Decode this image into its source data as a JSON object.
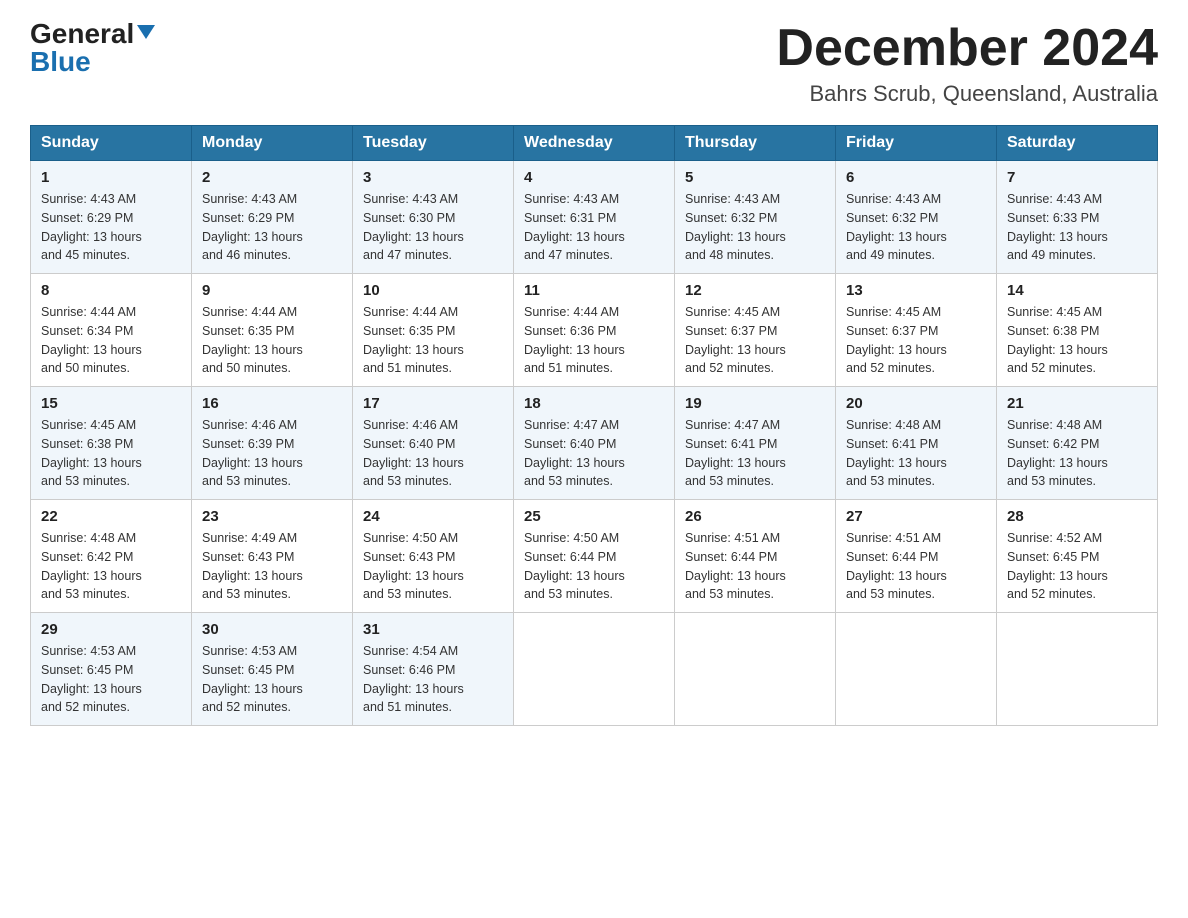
{
  "header": {
    "logo_general": "General",
    "logo_blue": "Blue",
    "title": "December 2024",
    "location": "Bahrs Scrub, Queensland, Australia"
  },
  "weekdays": [
    "Sunday",
    "Monday",
    "Tuesday",
    "Wednesday",
    "Thursday",
    "Friday",
    "Saturday"
  ],
  "weeks": [
    [
      {
        "day": "1",
        "sunrise": "4:43 AM",
        "sunset": "6:29 PM",
        "daylight": "13 hours and 45 minutes."
      },
      {
        "day": "2",
        "sunrise": "4:43 AM",
        "sunset": "6:29 PM",
        "daylight": "13 hours and 46 minutes."
      },
      {
        "day": "3",
        "sunrise": "4:43 AM",
        "sunset": "6:30 PM",
        "daylight": "13 hours and 47 minutes."
      },
      {
        "day": "4",
        "sunrise": "4:43 AM",
        "sunset": "6:31 PM",
        "daylight": "13 hours and 47 minutes."
      },
      {
        "day": "5",
        "sunrise": "4:43 AM",
        "sunset": "6:32 PM",
        "daylight": "13 hours and 48 minutes."
      },
      {
        "day": "6",
        "sunrise": "4:43 AM",
        "sunset": "6:32 PM",
        "daylight": "13 hours and 49 minutes."
      },
      {
        "day": "7",
        "sunrise": "4:43 AM",
        "sunset": "6:33 PM",
        "daylight": "13 hours and 49 minutes."
      }
    ],
    [
      {
        "day": "8",
        "sunrise": "4:44 AM",
        "sunset": "6:34 PM",
        "daylight": "13 hours and 50 minutes."
      },
      {
        "day": "9",
        "sunrise": "4:44 AM",
        "sunset": "6:35 PM",
        "daylight": "13 hours and 50 minutes."
      },
      {
        "day": "10",
        "sunrise": "4:44 AM",
        "sunset": "6:35 PM",
        "daylight": "13 hours and 51 minutes."
      },
      {
        "day": "11",
        "sunrise": "4:44 AM",
        "sunset": "6:36 PM",
        "daylight": "13 hours and 51 minutes."
      },
      {
        "day": "12",
        "sunrise": "4:45 AM",
        "sunset": "6:37 PM",
        "daylight": "13 hours and 52 minutes."
      },
      {
        "day": "13",
        "sunrise": "4:45 AM",
        "sunset": "6:37 PM",
        "daylight": "13 hours and 52 minutes."
      },
      {
        "day": "14",
        "sunrise": "4:45 AM",
        "sunset": "6:38 PM",
        "daylight": "13 hours and 52 minutes."
      }
    ],
    [
      {
        "day": "15",
        "sunrise": "4:45 AM",
        "sunset": "6:38 PM",
        "daylight": "13 hours and 53 minutes."
      },
      {
        "day": "16",
        "sunrise": "4:46 AM",
        "sunset": "6:39 PM",
        "daylight": "13 hours and 53 minutes."
      },
      {
        "day": "17",
        "sunrise": "4:46 AM",
        "sunset": "6:40 PM",
        "daylight": "13 hours and 53 minutes."
      },
      {
        "day": "18",
        "sunrise": "4:47 AM",
        "sunset": "6:40 PM",
        "daylight": "13 hours and 53 minutes."
      },
      {
        "day": "19",
        "sunrise": "4:47 AM",
        "sunset": "6:41 PM",
        "daylight": "13 hours and 53 minutes."
      },
      {
        "day": "20",
        "sunrise": "4:48 AM",
        "sunset": "6:41 PM",
        "daylight": "13 hours and 53 minutes."
      },
      {
        "day": "21",
        "sunrise": "4:48 AM",
        "sunset": "6:42 PM",
        "daylight": "13 hours and 53 minutes."
      }
    ],
    [
      {
        "day": "22",
        "sunrise": "4:48 AM",
        "sunset": "6:42 PM",
        "daylight": "13 hours and 53 minutes."
      },
      {
        "day": "23",
        "sunrise": "4:49 AM",
        "sunset": "6:43 PM",
        "daylight": "13 hours and 53 minutes."
      },
      {
        "day": "24",
        "sunrise": "4:50 AM",
        "sunset": "6:43 PM",
        "daylight": "13 hours and 53 minutes."
      },
      {
        "day": "25",
        "sunrise": "4:50 AM",
        "sunset": "6:44 PM",
        "daylight": "13 hours and 53 minutes."
      },
      {
        "day": "26",
        "sunrise": "4:51 AM",
        "sunset": "6:44 PM",
        "daylight": "13 hours and 53 minutes."
      },
      {
        "day": "27",
        "sunrise": "4:51 AM",
        "sunset": "6:44 PM",
        "daylight": "13 hours and 53 minutes."
      },
      {
        "day": "28",
        "sunrise": "4:52 AM",
        "sunset": "6:45 PM",
        "daylight": "13 hours and 52 minutes."
      }
    ],
    [
      {
        "day": "29",
        "sunrise": "4:53 AM",
        "sunset": "6:45 PM",
        "daylight": "13 hours and 52 minutes."
      },
      {
        "day": "30",
        "sunrise": "4:53 AM",
        "sunset": "6:45 PM",
        "daylight": "13 hours and 52 minutes."
      },
      {
        "day": "31",
        "sunrise": "4:54 AM",
        "sunset": "6:46 PM",
        "daylight": "13 hours and 51 minutes."
      },
      null,
      null,
      null,
      null
    ]
  ],
  "labels": {
    "sunrise": "Sunrise:",
    "sunset": "Sunset:",
    "daylight": "Daylight:"
  }
}
